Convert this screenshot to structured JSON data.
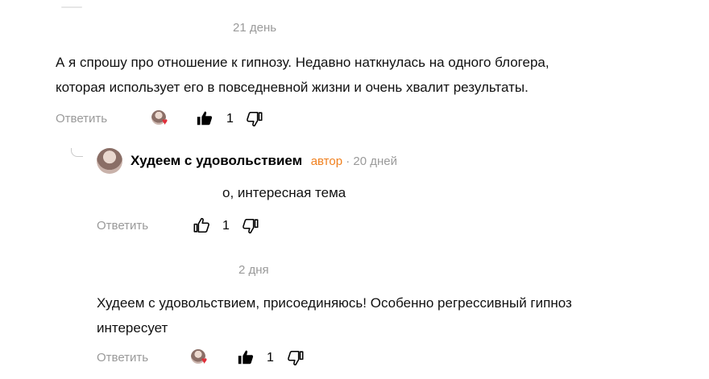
{
  "comment1": {
    "time": "21 день",
    "text_line1": "А я спрошу про отношение к гипнозу. Недавно наткнулась на одного блогера,",
    "text_line2": "которая использует его в повседневной жизни и очень хвалит результаты.",
    "reply_label": "Ответить",
    "likes": "1"
  },
  "comment2": {
    "author": "Худеем с удовольствием",
    "badge": "автор",
    "separator": " · ",
    "time": "20 дней",
    "text": "о, интересная тема",
    "reply_label": "Ответить",
    "likes": "1"
  },
  "comment3": {
    "time": "2 дня",
    "text_line1": "Худеем с удовольствием, присоединяюсь! Особенно регрессивный гипноз",
    "text_line2": "интересует",
    "reply_label": "Ответить",
    "likes": "1"
  },
  "colors": {
    "author_badge": "#f0801e",
    "muted": "#9a9a9a",
    "heart": "#e02f3a"
  },
  "icons": [
    "thumbs-up-filled-icon",
    "thumbs-down-outline-icon",
    "thumbs-up-outline-icon",
    "reply-arrow-icon",
    "liker-avatar-icon"
  ]
}
